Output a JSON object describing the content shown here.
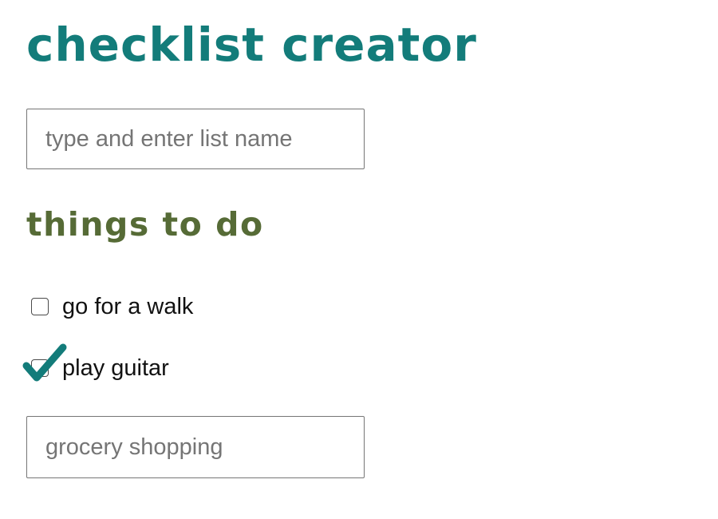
{
  "app": {
    "title": "checklist creator"
  },
  "list_name_input": {
    "value": "",
    "placeholder": "type and enter list name"
  },
  "list": {
    "heading": "things to do",
    "items": [
      {
        "label": "go for a walk",
        "checked": false
      },
      {
        "label": "play guitar",
        "checked": true
      }
    ]
  },
  "new_item_input": {
    "value": "",
    "placeholder": "grocery shopping"
  },
  "icons": {
    "check_mark": "check-mark-icon"
  },
  "colors": {
    "title": "#137c7a",
    "heading": "#566b36",
    "check_mark": "#137c7a"
  }
}
